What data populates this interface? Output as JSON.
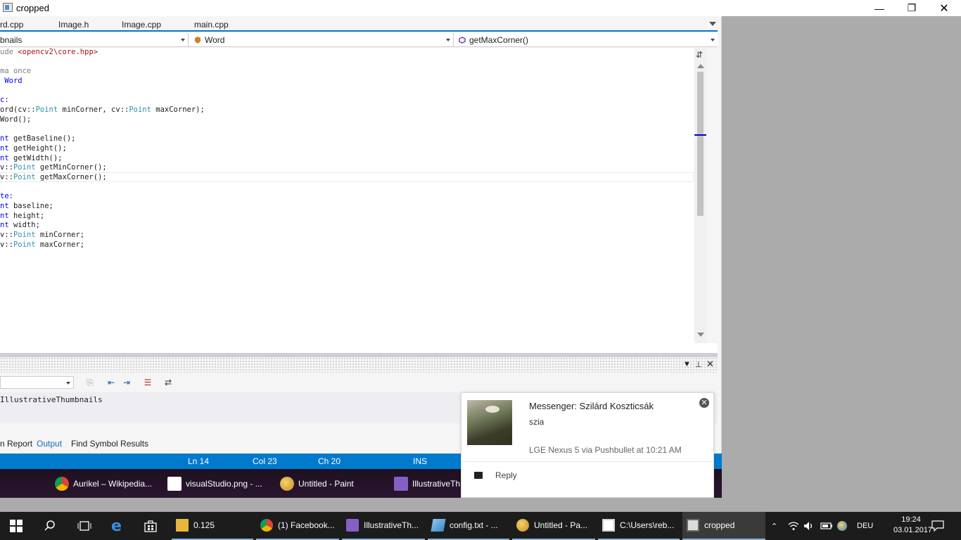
{
  "window": {
    "title": "cropped",
    "buttons": {
      "minimize": "—",
      "maximize": "❐",
      "close": "✕"
    }
  },
  "tabs": [
    {
      "label": "rd.cpp"
    },
    {
      "label": "Image.h"
    },
    {
      "label": "Image.cpp"
    },
    {
      "label": "main.cpp"
    }
  ],
  "navbar": {
    "project": "bnails",
    "class": "Word",
    "member": "getMaxCorner()"
  },
  "code_lines": [
    "ude <opencv2\\core.hpp>",
    "",
    "ma once",
    " Word",
    "",
    "c:",
    "ord(cv::Point minCorner, cv::Point maxCorner);",
    "Word();",
    "",
    "nt getBaseline();",
    "nt getHeight();",
    "nt getWidth();",
    "v::Point getMinCorner();",
    "v::Point getMaxCorner();",
    "",
    "te:",
    "nt baseline;",
    "nt height;",
    "nt width;",
    "v::Point minCorner;",
    "v::Point maxCorner;"
  ],
  "output": {
    "text": "IllustrativeThumbnails",
    "tabs": [
      {
        "label": "n Report"
      },
      {
        "label": "Output",
        "active": true
      },
      {
        "label": "Find Symbol Results"
      }
    ]
  },
  "status": {
    "ln": "Ln 14",
    "col": "Col 23",
    "ch": "Ch 20",
    "ins": "INS"
  },
  "inner_taskbar": [
    {
      "label": "Aurikel – Wikipedia...",
      "icon": "chrome-icon"
    },
    {
      "label": "visualStudio.png - ...",
      "icon": "image-viewer-icon"
    },
    {
      "label": "Untitled - Paint",
      "icon": "paint-icon"
    },
    {
      "label": "IllustrativeTh",
      "icon": "visual-studio-icon"
    }
  ],
  "notification": {
    "title": "Messenger: Szilárd Koszticsák",
    "body": "szia",
    "meta": "LGE Nexus 5 via Pushbullet at 10:21 AM",
    "action": "Reply"
  },
  "taskbar": {
    "items": [
      {
        "label": "0.125",
        "icon": "folder-icon"
      },
      {
        "label": "(1) Facebook...",
        "icon": "chrome-icon"
      },
      {
        "label": "IllustrativeTh...",
        "icon": "visual-studio-icon"
      },
      {
        "label": "config.txt - ...",
        "icon": "notepad-icon"
      },
      {
        "label": "Untitled - Pa...",
        "icon": "paint-icon"
      },
      {
        "label": "C:\\Users\\reb...",
        "icon": "console-icon"
      },
      {
        "label": "cropped",
        "icon": "image-viewer-icon",
        "active": true
      }
    ],
    "language": "DEU",
    "time": "19:24",
    "date": "03.01.2017"
  },
  "colors": {
    "accent": "#007acc",
    "keyword": "#0000ff",
    "type": "#2b91af",
    "taskbar": "#1c1c1c"
  }
}
